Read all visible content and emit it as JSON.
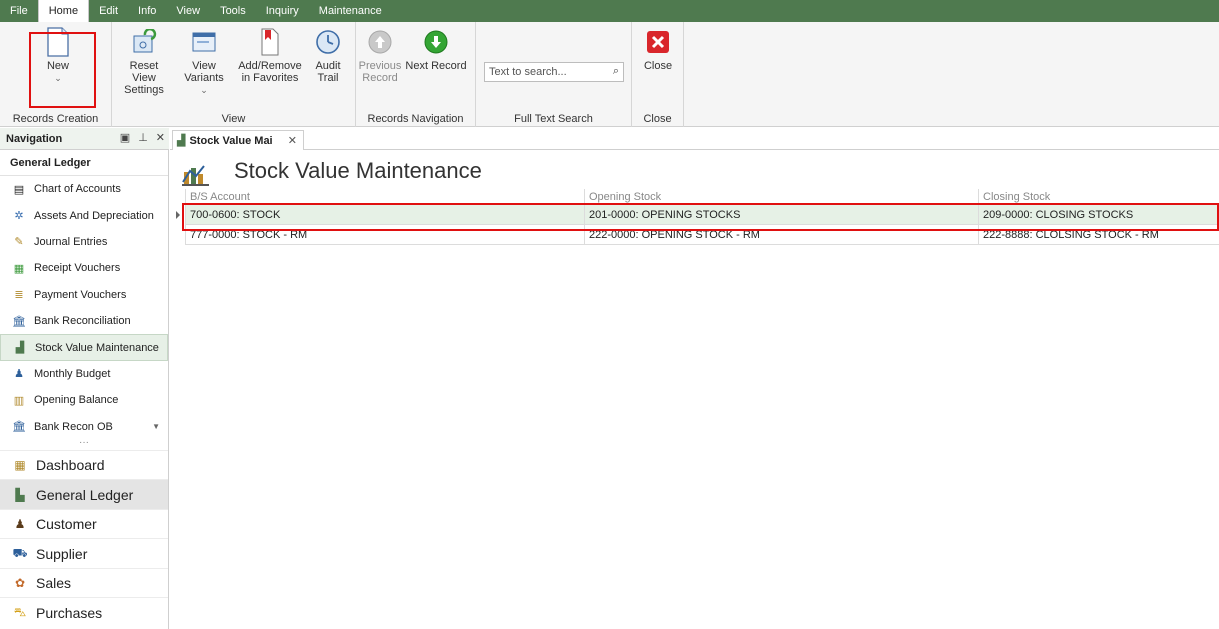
{
  "menu": {
    "items": [
      "File",
      "Home",
      "Edit",
      "Info",
      "View",
      "Tools",
      "Inquiry",
      "Maintenance"
    ],
    "active": "Home"
  },
  "ribbon": {
    "records_creation": {
      "new_label": "New",
      "caption": "Records Creation"
    },
    "view": {
      "reset_label": "Reset View Settings",
      "variants_label": "View Variants",
      "favorites_label": "Add/Remove in Favorites",
      "audit_label": "Audit Trail",
      "caption": "View"
    },
    "records_navigation": {
      "previous_label": "Previous Record",
      "next_label": "Next Record",
      "caption": "Records Navigation"
    },
    "full_text_search": {
      "placeholder": "Text to search...",
      "caption": "Full Text Search"
    },
    "close": {
      "close_label": "Close",
      "caption": "Close"
    }
  },
  "navigation": {
    "title": "Navigation",
    "section": "General Ledger",
    "items": [
      {
        "label": "Chart of Accounts",
        "icon": "book-icon"
      },
      {
        "label": "Assets And Depreciation",
        "icon": "gear-icon"
      },
      {
        "label": "Journal Entries",
        "icon": "pencil-icon"
      },
      {
        "label": "Receipt Vouchers",
        "icon": "receipt-icon"
      },
      {
        "label": "Payment Vouchers",
        "icon": "payment-icon"
      },
      {
        "label": "Bank Reconciliation",
        "icon": "bank-icon"
      },
      {
        "label": "Stock Value Maintenance",
        "icon": "chart-icon"
      },
      {
        "label": "Monthly Budget",
        "icon": "budget-icon"
      },
      {
        "label": "Opening Balance",
        "icon": "table-icon"
      },
      {
        "label": "Bank Recon OB",
        "icon": "bank-icon"
      }
    ],
    "selected_item": "Stock Value Maintenance",
    "modules": [
      {
        "label": "Dashboard",
        "icon": "dashboard-icon"
      },
      {
        "label": "General Ledger",
        "icon": "ledger-icon"
      },
      {
        "label": "Customer",
        "icon": "customer-icon"
      },
      {
        "label": "Supplier",
        "icon": "supplier-icon"
      },
      {
        "label": "Sales",
        "icon": "sales-icon"
      },
      {
        "label": "Purchases",
        "icon": "purchases-icon"
      }
    ],
    "selected_module": "General Ledger"
  },
  "tab": {
    "label": "Stock Value Mai"
  },
  "page": {
    "title": "Stock Value Maintenance"
  },
  "grid": {
    "columns": [
      "B/S Account",
      "Opening Stock",
      "Closing Stock"
    ],
    "rows": [
      [
        "700-0600: STOCK",
        "201-0000: OPENING STOCKS",
        "209-0000: CLOSING STOCKS"
      ],
      [
        "777-0000: STOCK - RM",
        "222-0000: OPENING STOCK - RM",
        "222-8888: CLOLSING STOCK - RM"
      ]
    ]
  },
  "colors": {
    "menubar": "#4f7a4f",
    "highlight_box": "#e01010",
    "selected_row": "#e6f1e6"
  }
}
